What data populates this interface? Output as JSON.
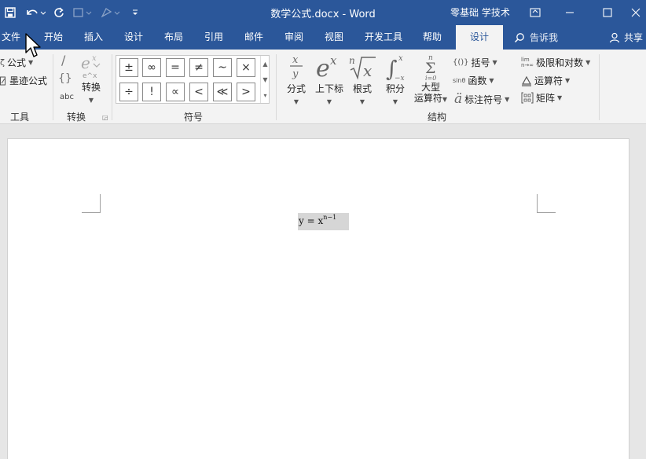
{
  "window": {
    "document_title": "数学公式.docx  -  Word",
    "user_name": "零基础 学技术"
  },
  "quick_access": [
    "save-icon",
    "undo-icon",
    "redo-icon",
    "touch-mode-icon",
    "customize-icon"
  ],
  "tabs": [
    {
      "label": "文件",
      "active": false
    },
    {
      "label": "开始",
      "active": false
    },
    {
      "label": "插入",
      "active": false
    },
    {
      "label": "设计",
      "active": false
    },
    {
      "label": "布局",
      "active": false
    },
    {
      "label": "引用",
      "active": false
    },
    {
      "label": "邮件",
      "active": false
    },
    {
      "label": "审阅",
      "active": false
    },
    {
      "label": "视图",
      "active": false
    },
    {
      "label": "开发工具",
      "active": false
    },
    {
      "label": "帮助",
      "active": false
    },
    {
      "label": "设计",
      "active": true
    }
  ],
  "tell_me": "告诉我",
  "share": "共享",
  "ribbon": {
    "tools": {
      "label": "工具",
      "equation": "公式",
      "ink_equation": "墨迹公式"
    },
    "conversions": {
      "label": "转换",
      "convert": "转换",
      "abc": "abc"
    },
    "symbols": {
      "label": "符号",
      "row1": [
        "±",
        "∞",
        "=",
        "≠",
        "~",
        "×"
      ],
      "row2": [
        "÷",
        "!",
        "∝",
        "<",
        "≪",
        ">"
      ]
    },
    "structures": {
      "label": "结构",
      "fraction": "分式",
      "script": "上下标",
      "radical": "根式",
      "integral": "积分",
      "large_operator_1": "大型",
      "large_operator_2": "运算符",
      "bracket": "括号",
      "function": "函数",
      "accent": "标注符号",
      "limit_log": "极限和对数",
      "operator": "运算符",
      "matrix": "矩阵"
    }
  },
  "document": {
    "equation_base": "y = x",
    "equation_exponent": "n−1"
  }
}
